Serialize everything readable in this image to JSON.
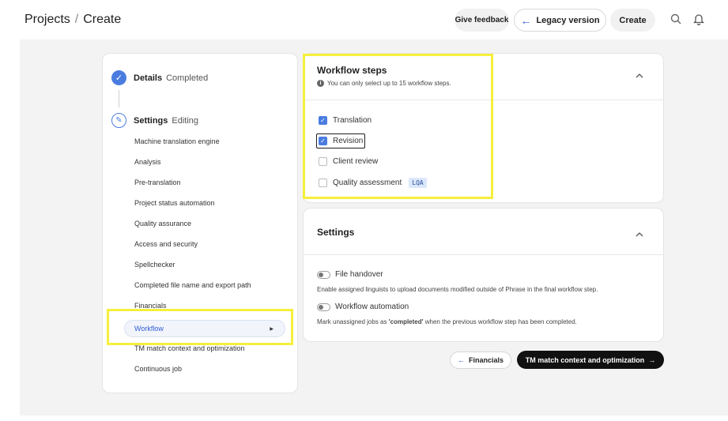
{
  "header": {
    "breadcrumb_root": "Projects",
    "breadcrumb_sep": "/",
    "breadcrumb_current": "Create",
    "feedback_label": "Give feedback",
    "legacy_label": "Legacy version",
    "create_label": "Create",
    "icons": [
      "search-icon",
      "bell-icon"
    ]
  },
  "steps": {
    "details": {
      "title": "Details",
      "status": "Completed"
    },
    "settings": {
      "title": "Settings",
      "status": "Editing"
    },
    "items": [
      "Machine translation engine",
      "Analysis",
      "Pre-translation",
      "Project status automation",
      "Quality assurance",
      "Access and security",
      "Spellchecker",
      "Completed file name and export path",
      "Financials",
      "Workflow",
      "TM match context and optimization",
      "Continuous job"
    ],
    "active_item": "Workflow"
  },
  "workflow": {
    "title": "Workflow steps",
    "info": "You can only select up to 15 workflow steps.",
    "options": [
      {
        "label": "Translation",
        "checked": true
      },
      {
        "label": "Revision",
        "checked": true
      },
      {
        "label": "Client review",
        "checked": false
      },
      {
        "label": "Quality assessment",
        "checked": false,
        "badge": "LQA"
      }
    ]
  },
  "settings_card": {
    "title": "Settings",
    "file_handover_label": "File handover",
    "file_handover_desc": "Enable assigned linguists to upload documents modified outside of Phrase in the final workflow step.",
    "workflow_automation_label": "Workflow automation",
    "workflow_automation_desc_pre": "Mark unassigned jobs as ",
    "workflow_automation_desc_bold": "'completed'",
    "workflow_automation_desc_post": " when the previous workflow step has been completed."
  },
  "nav": {
    "prev_label": "Financials",
    "next_label": "TM match context and optimization"
  },
  "colors": {
    "accent": "#4a7ce0",
    "highlight": "#f6ef3c",
    "dark_button": "#111111"
  }
}
